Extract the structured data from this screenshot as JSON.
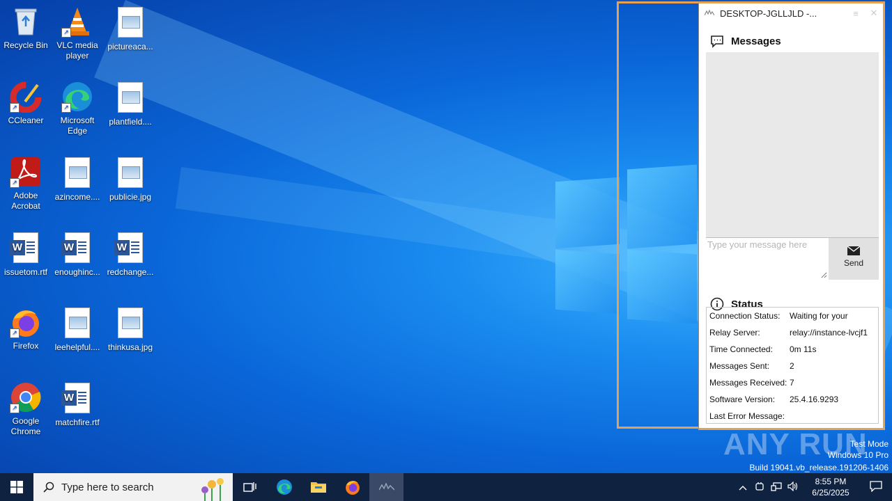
{
  "desktop": {
    "icons": [
      {
        "label": "Recycle Bin"
      },
      {
        "label": "VLC media player"
      },
      {
        "label": "pictureaca..."
      },
      {
        "label": "CCleaner"
      },
      {
        "label": "Microsoft Edge"
      },
      {
        "label": "plantfield...."
      },
      {
        "label": "Adobe Acrobat"
      },
      {
        "label": "azincome...."
      },
      {
        "label": "publicie.jpg"
      },
      {
        "label": "issuetom.rtf"
      },
      {
        "label": "enoughinc..."
      },
      {
        "label": "redchange..."
      },
      {
        "label": "Firefox"
      },
      {
        "label": "leehelpful...."
      },
      {
        "label": "thinkusa.jpg"
      },
      {
        "label": "Google Chrome"
      },
      {
        "label": "matchfire.rtf"
      }
    ]
  },
  "window": {
    "title": "DESKTOP-JGLLJLD -...",
    "messages": {
      "heading": "Messages",
      "input_placeholder": "Type your message here",
      "send_label": "Send"
    },
    "status": {
      "heading": "Status",
      "rows": [
        {
          "key": "Connection Status:",
          "value": "Waiting for your"
        },
        {
          "key": "Relay Server:",
          "value": "relay://instance-lvcjf1"
        },
        {
          "key": "Time Connected:",
          "value": "0m 11s"
        },
        {
          "key": "Messages Sent:",
          "value": "2"
        },
        {
          "key": "Messages Received:",
          "value": "7"
        },
        {
          "key": "Software Version:",
          "value": "25.4.16.9293"
        },
        {
          "key": "Last Error Message:",
          "value": ""
        }
      ]
    }
  },
  "watermark": {
    "brand": "ANY RUN",
    "line1": "Test Mode",
    "line2": "Windows 10 Pro",
    "line3": "Build 19041.vb_release.191206-1406"
  },
  "taskbar": {
    "search_placeholder": "Type here to search",
    "time": "8:55 PM",
    "date": "6/25/2025"
  },
  "colors": {
    "selection_border": "#e9a050",
    "taskbar_bg": "#0f2240",
    "accent_blue": "#0a66d8"
  }
}
